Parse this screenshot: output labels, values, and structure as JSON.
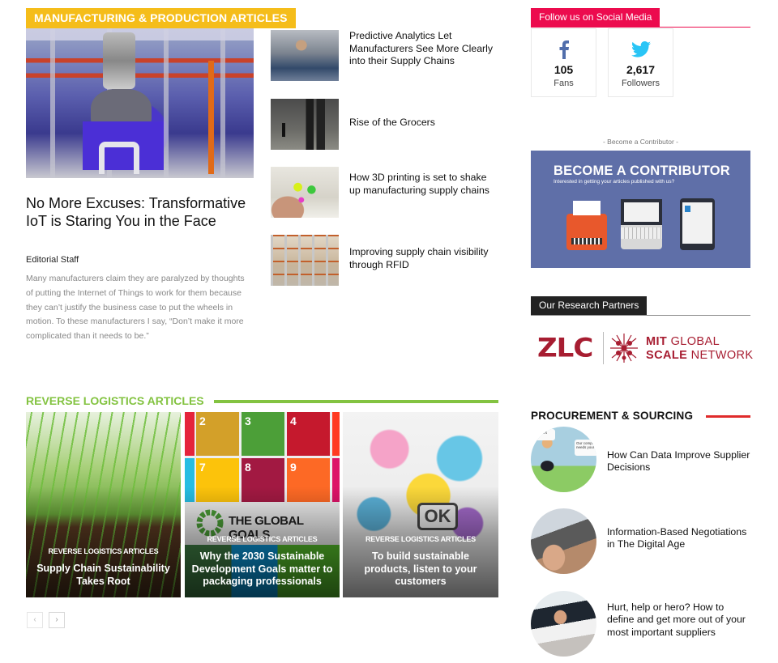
{
  "manufacturing": {
    "header": "MANUFACTURING & PRODUCTION ARTICLES",
    "featured": {
      "title": "No More Excuses: Transformative IoT is Staring You in the Face",
      "author": "Editorial Staff",
      "excerpt": "Many manufacturers claim they are paralyzed by thoughts of putting the Internet of Things to work for them because they can’t justify the business case to put the wheels in motion. To these manufacturers I say, “Don’t make it more complicated than it needs to be.”"
    },
    "list": [
      {
        "title": "Predictive Analytics Let Manufacturers See More Clearly into their Supply Chains"
      },
      {
        "title": "Rise of the Grocers"
      },
      {
        "title": "How 3D printing is set to shake up manufacturing supply chains"
      },
      {
        "title": "Improving supply chain visibility through RFID"
      }
    ]
  },
  "social": {
    "header": "Follow us on Social Media",
    "facebook": {
      "icon": "facebook-icon",
      "count": "105",
      "label": "Fans",
      "color": "#516eab"
    },
    "twitter": {
      "icon": "twitter-icon",
      "count": "2,617",
      "label": "Followers",
      "color": "#29c5f6"
    }
  },
  "contributor": {
    "label": "- Become a Contributor -",
    "banner_title": "BECOME A CONTRIBUTOR",
    "banner_subtitle": "Interested in getting your articles published with us?"
  },
  "partners": {
    "header": "Our Research Partners",
    "zlc": "ZLC",
    "mit_line1_bold": "MIT",
    "mit_line1_rest": " GLOBAL",
    "mit_line2_bold": "SCALE",
    "mit_line2_rest": " NETWORK"
  },
  "reverse_logistics": {
    "header": "REVERSE LOGISTICS ARTICLES",
    "cards": [
      {
        "category": "REVERSE LOGISTICS ARTICLES",
        "title": "Supply Chain Sustainability Takes Root"
      },
      {
        "category": "REVERSE LOGISTICS ARTICLES",
        "title": "Why the 2030 Sustainable Development Goals matter to packaging professionals"
      },
      {
        "category": "REVERSE LOGISTICS ARTICLES",
        "title": "To build sustainable products, listen to your customers"
      }
    ],
    "sdg_banner": "THE GLOBAL GOALS",
    "sdg_tiles": [
      {
        "num": "2",
        "color": "#d3a029"
      },
      {
        "num": "3",
        "color": "#4c9f38"
      },
      {
        "num": "4",
        "color": "#c5192d"
      },
      {
        "num": "7",
        "color": "#fcc30b"
      },
      {
        "num": "8",
        "color": "#a21942"
      },
      {
        "num": "9",
        "color": "#fd6925"
      }
    ],
    "ok_text": "OK",
    "pager_prev": "‹",
    "pager_next": "›"
  },
  "procurement": {
    "header": "PROCUREMENT & SOURCING",
    "items": [
      {
        "title": "How Can Data Improve Supplier Decisions",
        "bubble1": "suppliers",
        "bubble2": "Our company needs your"
      },
      {
        "title": "Information-Based Negotiations in The Digital Age"
      },
      {
        "title": "Hurt, help or hero? How to define and get more out of your most important suppliers"
      }
    ]
  },
  "colors": {
    "manufacturing_accent": "#f5bd1a",
    "social_accent": "#ec0b4e",
    "reverse_logistics_accent": "#83c341",
    "procurement_accent": "#e02b2b",
    "contributor_banner": "#5f6fa8",
    "partner_brand": "#a71d31"
  }
}
